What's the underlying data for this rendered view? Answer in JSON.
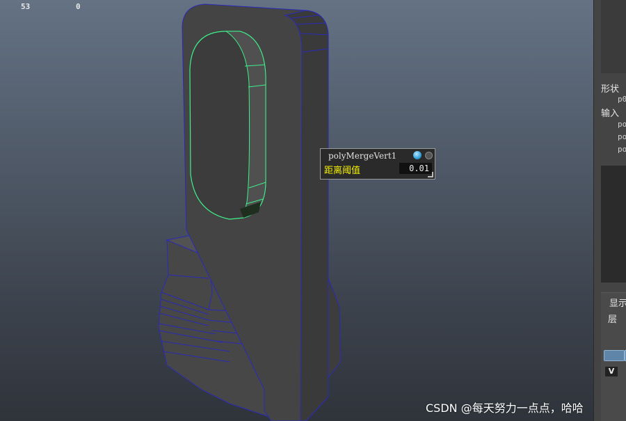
{
  "hud": {
    "left_value": "53",
    "right_value": "0"
  },
  "merge_popup": {
    "node_name": "polyMergeVert1",
    "attribute_label": "距离阈值",
    "attribute_value": "0.01"
  },
  "side_panel": {
    "section_shape": "形状",
    "shape_item": "p0",
    "section_input": "输入",
    "input_items": [
      "po",
      "po",
      "po"
    ],
    "display_tab": "显示",
    "layer_tab": "层",
    "visibility_toggle": "V"
  },
  "watermark": "CSDN @每天努力一点点，哈哈",
  "colors": {
    "mesh_face": "#434343",
    "wireframe": "#2a2ab8",
    "selected_edges": "#3df28a",
    "label_yellow": "#f4f000"
  }
}
